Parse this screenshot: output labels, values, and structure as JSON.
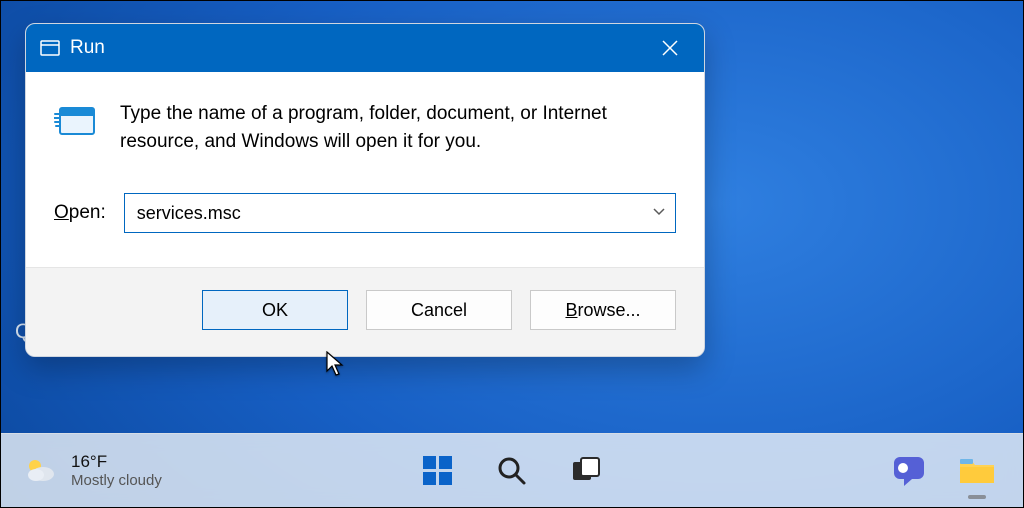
{
  "dialog": {
    "title": "Run",
    "description": "Type the name of a program, folder, document, or Internet resource, and Windows will open it for you.",
    "open_label_pre": "O",
    "open_label_rest": "pen:",
    "input_value": "services.msc",
    "ok_label": "OK",
    "cancel_label": "Cancel",
    "browse_label_pre": "B",
    "browse_label_rest": "rowse..."
  },
  "desktop": {
    "stray_letter": "Q"
  },
  "taskbar": {
    "temperature": "16°F",
    "condition": "Mostly cloudy"
  },
  "colors": {
    "accent": "#0067c0"
  }
}
